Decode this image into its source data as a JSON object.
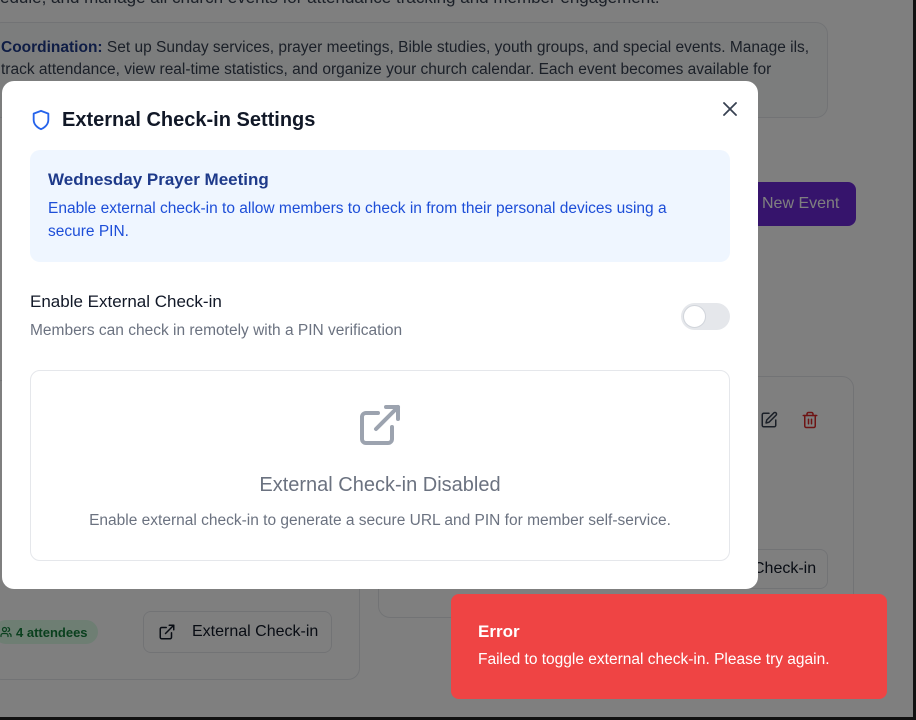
{
  "background": {
    "intro_line": "edule, and manage all church events for attendance tracking and member engagement.",
    "info_card": {
      "bold_label": "Coordination:",
      "text": " Set up Sunday services, prayer meetings, Bible studies, youth groups, and special events. Manage ils, track attendance, view real-time statistics, and organize your church calendar. Each event becomes available for"
    },
    "new_event_label": "New Event",
    "checkin_right_label": "Check-in",
    "attendees_badge": "4 attendees",
    "external_checkin_button": "External Check-in"
  },
  "modal": {
    "title": "External Check-in Settings",
    "info": {
      "event_name": "Wednesday Prayer Meeting",
      "description": "Enable external check-in to allow members to check in from their personal devices using a secure PIN."
    },
    "toggle": {
      "label": "Enable External Check-in",
      "description": "Members can check in remotely with a PIN verification",
      "enabled": false
    },
    "disabled_state": {
      "title": "External Check-in Disabled",
      "description": "Enable external check-in to generate a secure URL and PIN for member self-service."
    }
  },
  "toast": {
    "title": "Error",
    "message": "Failed to toggle external check-in. Please try again.",
    "color": "#ef4444"
  },
  "icons": {
    "header": "shield-icon",
    "close": "close-icon",
    "disabled_state": "external-link-icon"
  }
}
